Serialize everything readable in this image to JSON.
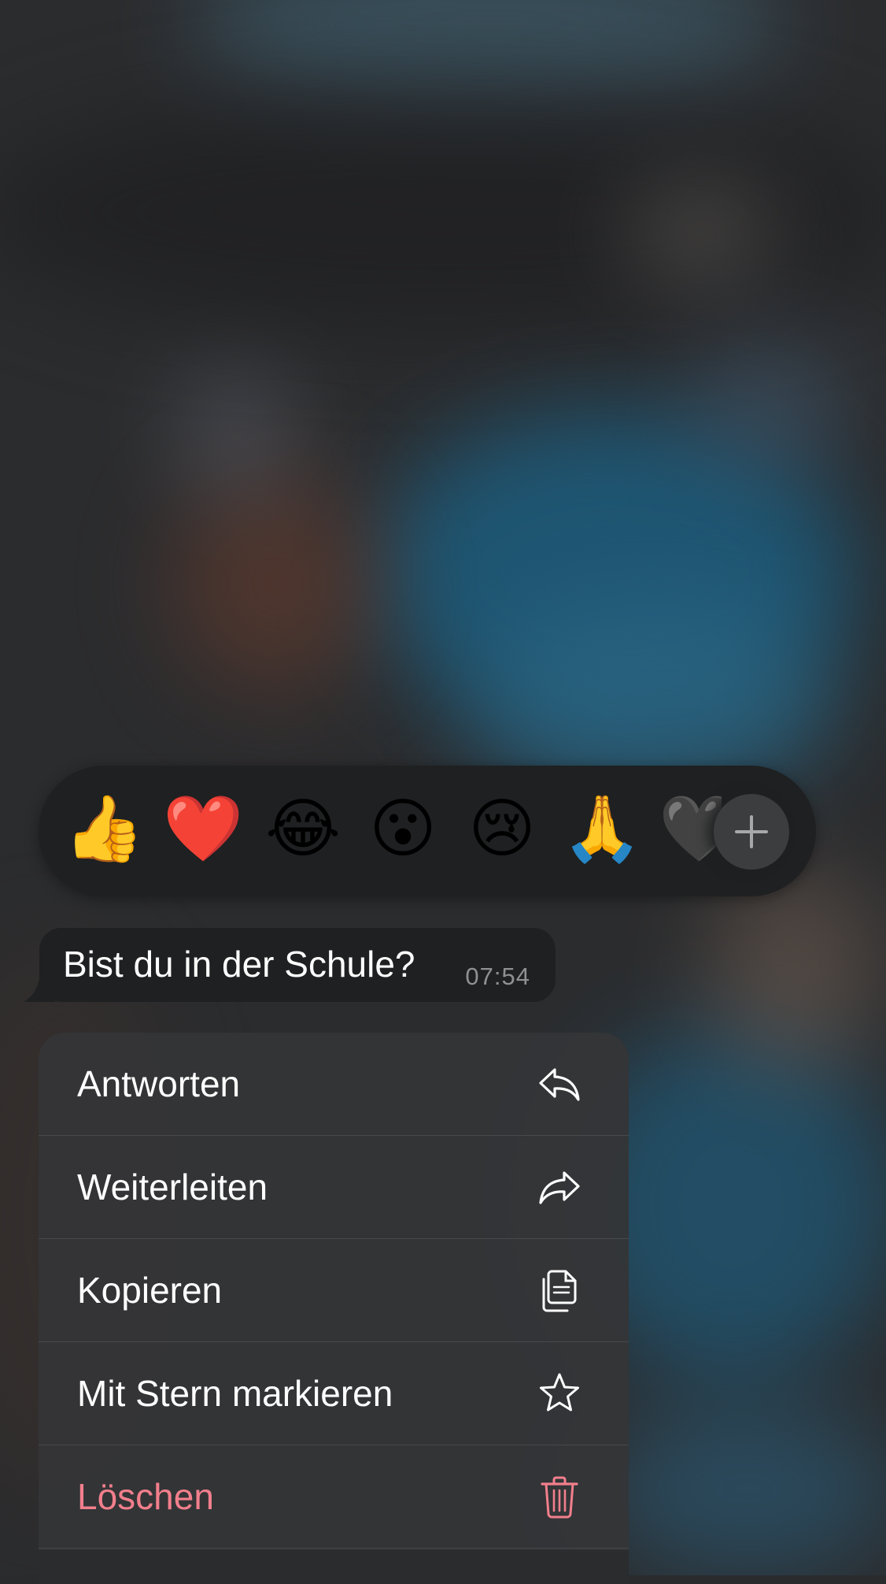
{
  "reactions": {
    "emojis": [
      {
        "glyph": "👍",
        "icon": "thumbs-up-icon"
      },
      {
        "glyph": "❤️",
        "icon": "red-heart-icon"
      },
      {
        "glyph": "😂",
        "icon": "tears-of-joy-icon"
      },
      {
        "glyph": "😮",
        "icon": "surprised-face-icon"
      },
      {
        "glyph": "😢",
        "icon": "crying-face-icon"
      },
      {
        "glyph": "🙏",
        "icon": "folded-hands-icon"
      },
      {
        "glyph": "🖤",
        "icon": "black-heart-icon"
      }
    ],
    "more_icon": "plus-icon"
  },
  "message": {
    "text": "Bist du in der Schule?",
    "time": "07:54"
  },
  "menu": {
    "items": [
      {
        "label": "Antworten",
        "icon": "reply-icon"
      },
      {
        "label": "Weiterleiten",
        "icon": "forward-icon"
      },
      {
        "label": "Kopieren",
        "icon": "copy-icon"
      },
      {
        "label": "Mit Stern markieren",
        "icon": "star-icon"
      },
      {
        "label": "Löschen",
        "icon": "trash-icon"
      }
    ]
  },
  "colors": {
    "bubble": "#1f2021",
    "menu": "#343537",
    "danger": "#f27f8c",
    "time": "#8e9193"
  }
}
